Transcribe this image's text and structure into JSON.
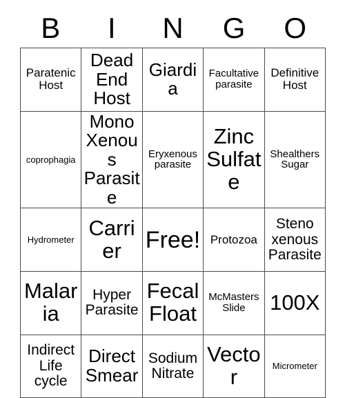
{
  "card": {
    "header_letters": [
      "B",
      "I",
      "N",
      "G",
      "O"
    ],
    "free_space_label": "Free!",
    "rows": [
      [
        {
          "text": "Paratenic Host",
          "size": "m"
        },
        {
          "text": "Dead End Host",
          "size": "xl"
        },
        {
          "text": "Giardia",
          "size": "xl"
        },
        {
          "text": "Facultative parasite",
          "size": "s"
        },
        {
          "text": "Definitive Host",
          "size": "m"
        }
      ],
      [
        {
          "text": "coprophagia",
          "size": "xs"
        },
        {
          "text": "Mono Xenous Parasite",
          "size": "xl"
        },
        {
          "text": "Eryxenous parasite",
          "size": "s"
        },
        {
          "text": "Zinc Sulfate",
          "size": "xxl"
        },
        {
          "text": "Shealthers Sugar",
          "size": "s"
        }
      ],
      [
        {
          "text": "Hydrometer",
          "size": "xs"
        },
        {
          "text": "Carrier",
          "size": "xxl"
        },
        {
          "text": "Free!",
          "size": "free"
        },
        {
          "text": "Protozoa",
          "size": "m"
        },
        {
          "text": "Steno xenous Parasite",
          "size": "l"
        }
      ],
      [
        {
          "text": "Malaria",
          "size": "xxl"
        },
        {
          "text": "Hyper Parasite",
          "size": "l"
        },
        {
          "text": "Fecal Float",
          "size": "xxl"
        },
        {
          "text": "McMasters Slide",
          "size": "s"
        },
        {
          "text": "100X",
          "size": "xxl"
        }
      ],
      [
        {
          "text": "Indirect Life cycle",
          "size": "l"
        },
        {
          "text": "Direct Smear",
          "size": "xl"
        },
        {
          "text": "Sodium Nitrate",
          "size": "l"
        },
        {
          "text": "Vector",
          "size": "xxl"
        },
        {
          "text": "Micrometer",
          "size": "xs"
        }
      ]
    ]
  },
  "colors": {
    "background": "#ffffff",
    "text": "#000000",
    "grid_line": "#4a4a4a"
  }
}
